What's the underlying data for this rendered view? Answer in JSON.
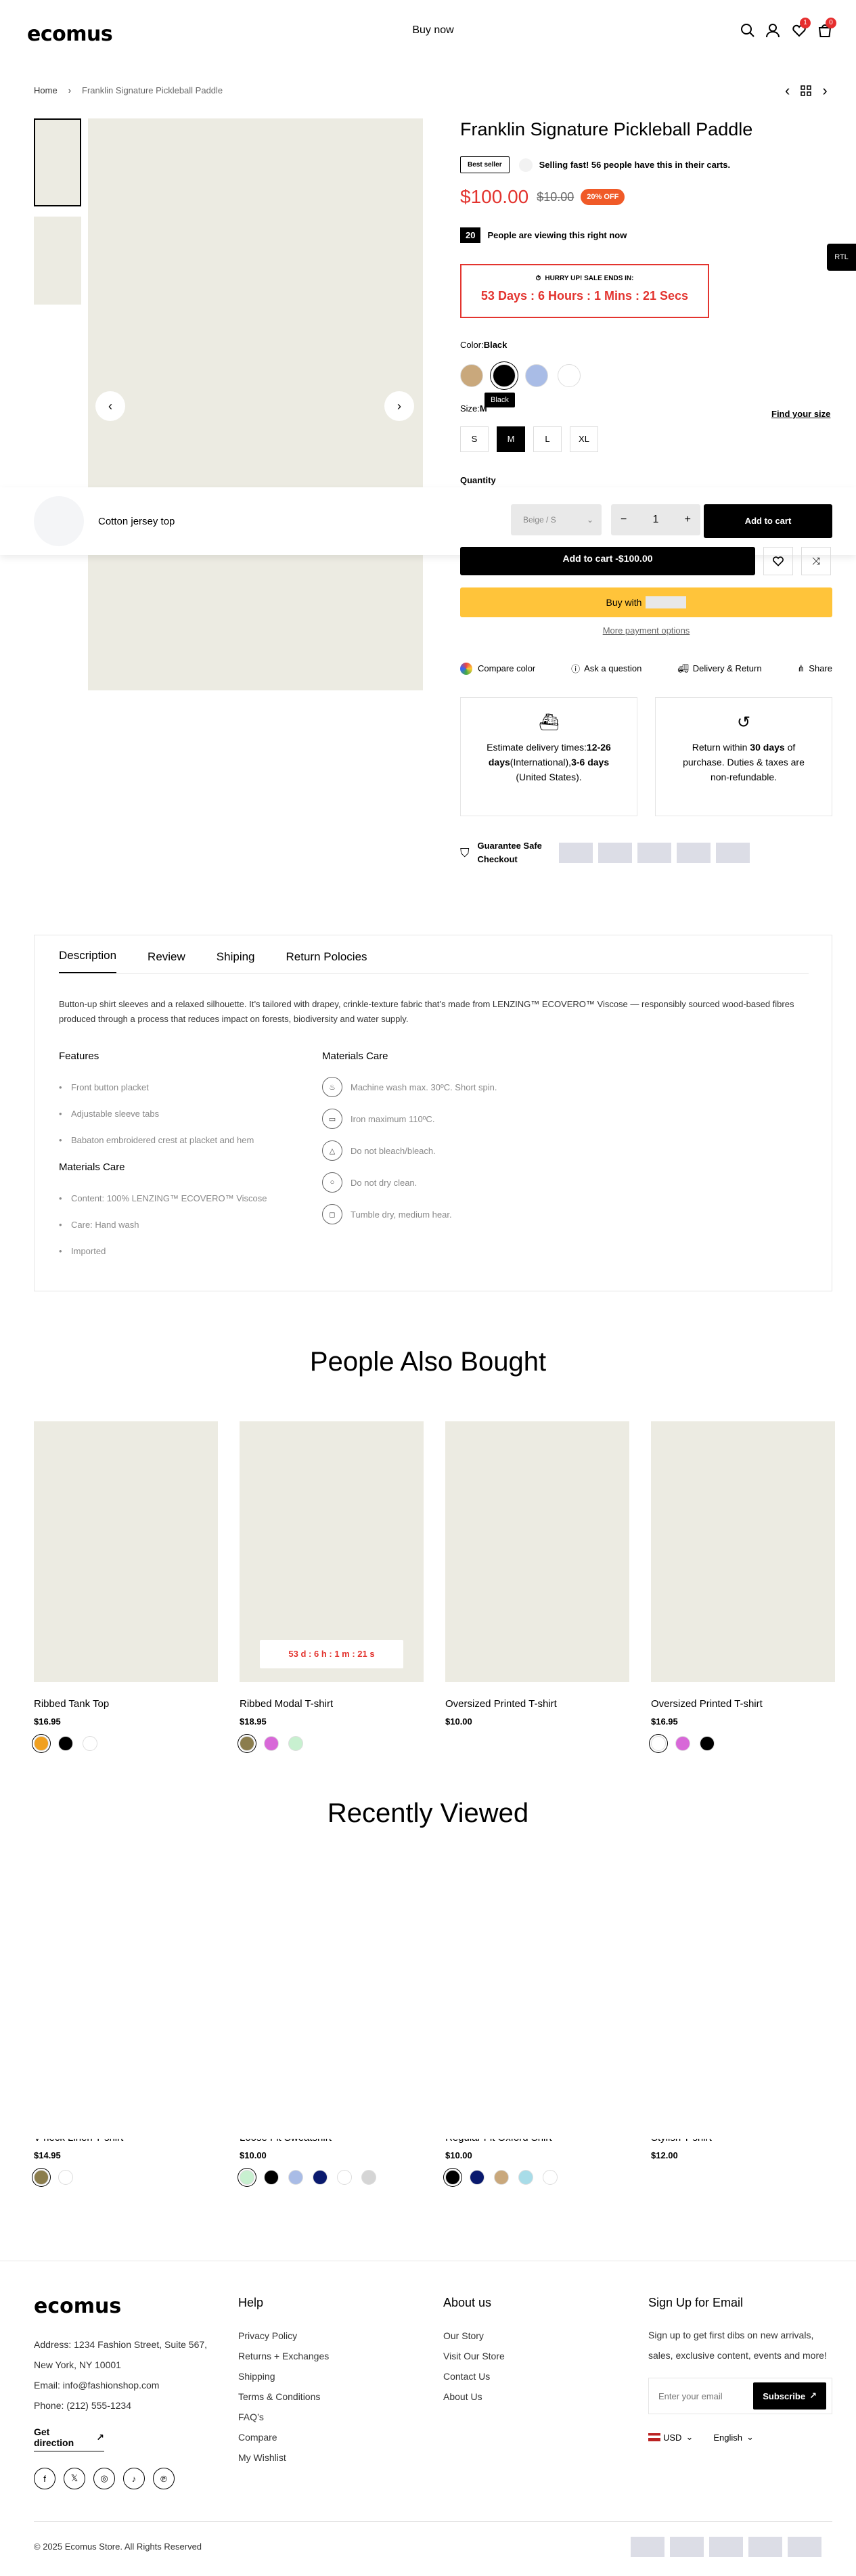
{
  "header": {
    "logo": "ecomus",
    "nav": "Buy now",
    "wishlist_count": "1",
    "cart_count": "0"
  },
  "breadcrumb": {
    "home": "Home",
    "current": "Franklin Signature Pickleball Paddle"
  },
  "product": {
    "title": "Franklin Signature Pickleball Paddle",
    "badge": "Best seller",
    "selling": "Selling fast! 56 people have this in their carts.",
    "price": "$100.00",
    "old_price": "$10.00",
    "discount": "20% OFF",
    "viewers": "20",
    "viewers_text": "People are viewing this right now",
    "hurry": "HURRY UP! SALE ENDS IN:",
    "countdown": "53 Days : 6 Hours : 1 Mins : 21 Secs",
    "color_label": "Color:",
    "color_value": "Black",
    "color_tooltip": "Black",
    "size_label": "Size:",
    "size_value": "M",
    "find_size": "Find your size",
    "sizes": [
      "S",
      "M",
      "L",
      "XL"
    ],
    "quantity_label": "Quantity",
    "add_to_cart": "Add to cart -$100.00",
    "buy_with": "Buy with",
    "more_payment": "More payment options",
    "actions": [
      "Compare color",
      "Ask a question",
      "Delivery & Return",
      "Share"
    ],
    "delivery_pre": "Estimate delivery times:",
    "delivery_intl_days": "12-26 days",
    "delivery_intl": "(International),",
    "delivery_us_days": "3-6 days",
    "delivery_us": "(United States).",
    "return_pre": "Return within",
    "return_days": "30 days",
    "return_post": "of purchase. Duties & taxes are non-refundable.",
    "guarantee": "Guarantee Safe Checkout",
    "rtl": "RTL",
    "swatch_colors": [
      "#c9a87c",
      "#000000",
      "#a9bce6",
      "#ffffff"
    ]
  },
  "sticky": {
    "name": "Cotton jersey top",
    "variant": "Beige / S",
    "qty": "1",
    "add": "Add to cart",
    "minus": "−",
    "plus": "+"
  },
  "tabs": {
    "labels": [
      "Description",
      "Review",
      "Shiping",
      "Return Polocies"
    ],
    "description": "Button-up shirt sleeves and a relaxed silhouette. It’s tailored with drapey, crinkle-texture fabric that’s made from LENZING™ ECOVERO™ Viscose — responsibly sourced wood-based fibres produced through a process that reduces impact on forests, biodiversity and water supply.",
    "features_title": "Features",
    "features": [
      "Front button placket",
      "Adjustable sleeve tabs",
      "Babaton embroidered crest at placket and hem"
    ],
    "materials_title": "Materials Care",
    "materials": [
      "Content: 100% LENZING™ ECOVERO™ Viscose",
      "Care: Hand wash",
      "Imported"
    ],
    "care_title": "Materials Care",
    "care": [
      "Machine wash max. 30ºC. Short spin.",
      "Iron maximum 110ºC.",
      "Do not bleach/bleach.",
      "Do not dry clean.",
      "Tumble dry, medium hear."
    ]
  },
  "also_bought": {
    "title": "People Also Bought",
    "countdown": "53 d : 6 h : 1 m : 21 s",
    "items": [
      {
        "name": "Ribbed Tank Top",
        "price": "$16.95",
        "colors": [
          "#f0a020",
          "#000000",
          "#ffffff"
        ]
      },
      {
        "name": "Ribbed Modal T-shirt",
        "price": "$18.95",
        "colors": [
          "#8b7d4d",
          "#d868d8",
          "#c8f0d0"
        ]
      },
      {
        "name": "Oversized Printed T-shirt",
        "price": "$10.00",
        "colors": []
      },
      {
        "name": "Oversized Printed T-shirt",
        "price": "$16.95",
        "colors": [
          "#ffffff",
          "#d868d8",
          "#000000"
        ]
      }
    ]
  },
  "recent": {
    "title": "Recently Viewed",
    "items": [
      {
        "name": "V-neck Linen T-shirt",
        "price": "$14.95",
        "colors": [
          "#8b7d4d",
          "#ffffff"
        ]
      },
      {
        "name": "Loose Fit Sweatshirt",
        "price": "$10.00",
        "colors": [
          "#c8f0d0",
          "#000000",
          "#a9bce6",
          "#0a1a6e",
          "#ffffff",
          "#d5d5d5"
        ]
      },
      {
        "name": "Regular Fit Oxford Shirt",
        "price": "$10.00",
        "colors": [
          "#000000",
          "#0a1a6e",
          "#c9a87c",
          "#a8dce8",
          "#ffffff"
        ]
      },
      {
        "name": "Stylish T-shirt",
        "price": "$12.00",
        "colors": []
      }
    ]
  },
  "footer": {
    "logo": "ecomus",
    "address": "Address: 1234 Fashion Street, Suite 567,",
    "address2": "New York, NY 10001",
    "email": "Email: info@fashionshop.com",
    "phone": "Phone: (212) 555-1234",
    "direction": "Get direction",
    "help_title": "Help",
    "help": [
      "Privacy Policy",
      "Returns + Exchanges",
      "Shipping",
      "Terms & Conditions",
      "FAQ’s",
      "Compare",
      "My Wishlist"
    ],
    "about_title": "About us",
    "about": [
      "Our Story",
      "Visit Our Store",
      "Contact Us",
      "About Us"
    ],
    "signup_title": "Sign Up for Email",
    "signup_text": "Sign up to get first dibs on new arrivals, sales, exclusive content, events and more!",
    "email_placeholder": "Enter your email",
    "subscribe": "Subscribe",
    "currency": "USD",
    "language": "English",
    "copyright": "© 2025 Ecomus Store. All Rights Reserved",
    "social": [
      "f",
      "𝕏",
      "◎",
      "♪",
      "℗"
    ]
  }
}
